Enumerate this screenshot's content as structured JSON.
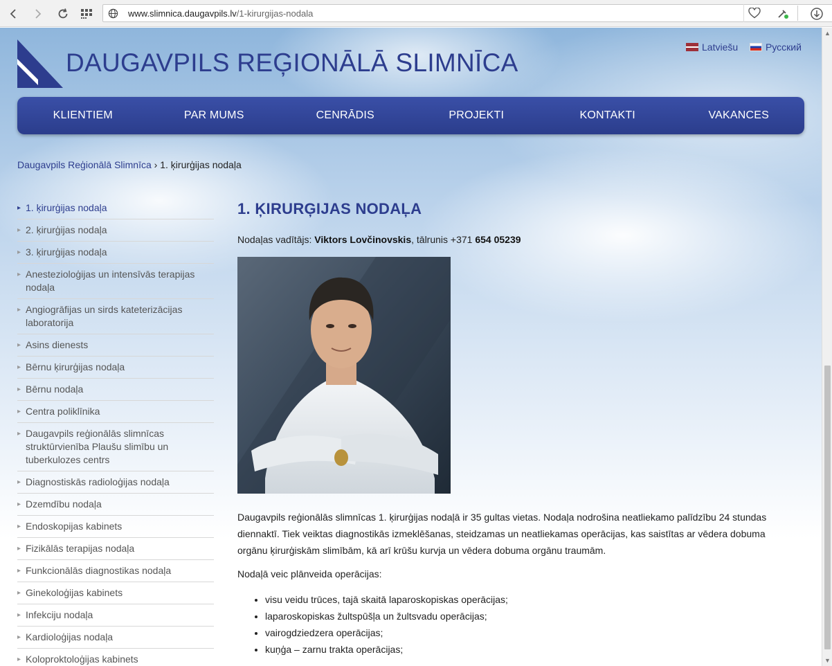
{
  "browser": {
    "url_host": "www.slimnica.daugavpils.lv",
    "url_path": "/1-kirurgijas-nodala"
  },
  "header": {
    "site_title": "DAUGAVPILS REĢIONĀLĀ SLIMNĪCA",
    "languages": [
      {
        "label": "Latviešu",
        "flag": "lv"
      },
      {
        "label": "Русский",
        "flag": "ru"
      }
    ]
  },
  "nav": {
    "items": [
      "KLIENTIEM",
      "PAR MUMS",
      "CENRĀDIS",
      "PROJEKTI",
      "KONTAKTI",
      "VAKANCES"
    ]
  },
  "breadcrumb": {
    "home": "Daugavpils Reģionālā Slimnīca",
    "separator": "›",
    "current": "1. ķirurģijas nodaļa"
  },
  "sidebar": {
    "items": [
      "1. ķirurģijas nodaļa",
      "2. ķirurģijas nodaļa",
      "3. ķirurģijas nodaļa",
      "Anestezioloģijas un intensīvās terapijas nodaļa",
      "Angiogrāfijas un sirds kateterizācijas laboratorija",
      "Asins dienests",
      "Bērnu ķirurģijas nodaļa",
      "Bērnu nodaļa",
      "Centra poliklīnika",
      "Daugavpils reģionālās slimnīcas struktūrvienība Plaušu slimību un tuberkulozes centrs",
      "Diagnostiskās radioloģijas nodaļa",
      "Dzemdību nodaļa",
      "Endoskopijas kabinets",
      "Fizikālās terapijas nodaļa",
      "Funkcionālās diagnostikas nodaļa",
      "Ginekoloģijas kabinets",
      "Infekciju nodaļa",
      "Kardioloģijas nodaļa",
      "Koloproktoloģijas kabinets"
    ],
    "active_index": 0
  },
  "content": {
    "title": "1. ĶIRURĢIJAS NODAĻA",
    "head_label": "Nodaļas vadītājs: ",
    "head_name": "Viktors Lovčinovskis",
    "phone_label": ", tālrunis +371 ",
    "phone_number": "654 05239",
    "paragraph": "Daugavpils reģionālās slimnīcas 1. ķirurģijas nodaļā ir 35 gultas vietas. Nodaļa nodrošina neatliekamo palīdzību 24 stundas diennaktī. Tiek veiktas diagnostikās izmeklēšanas, steidzamas un neatliekamas operācijas, kas saistītas ar vēdera dobuma orgānu ķirurģiskām slimībām, kā arī krūšu kurvja un vēdera dobuma orgānu traumām.",
    "intro": "Nodaļā veic plānveida operācijas:",
    "operations": [
      "visu veidu trūces, tajā skaitā laparoskopiskas operācijas;",
      "laparoskopiskas žultspūšļa un žultsvadu operācijas;",
      "vairogdziedzera operācijas;",
      "kuņģa – zarnu trakta operācijas;"
    ]
  },
  "colors": {
    "brand": "#2d3d8e",
    "nav_bg": "#33479b"
  }
}
